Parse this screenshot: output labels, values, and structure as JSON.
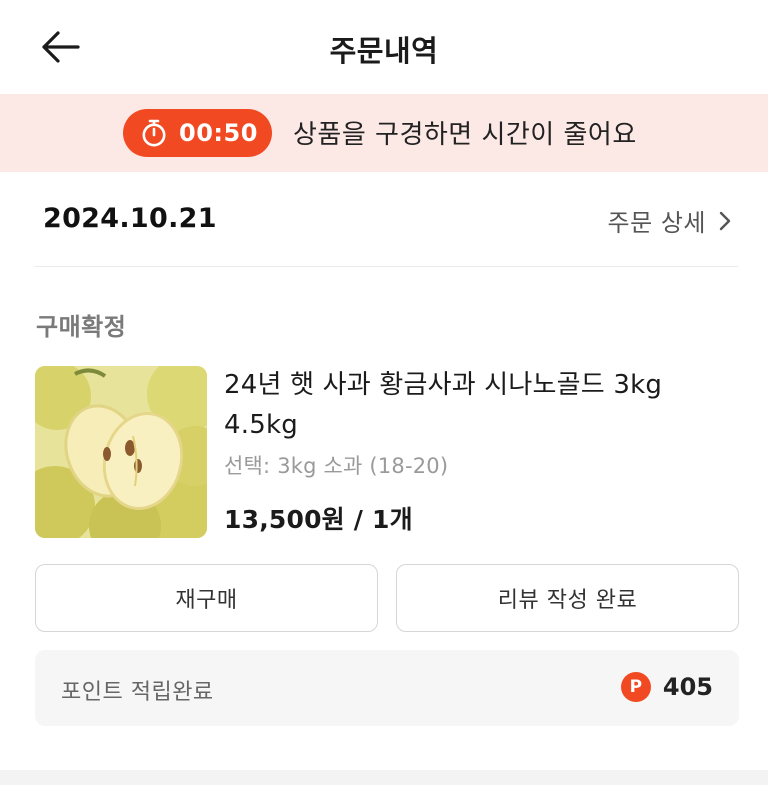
{
  "header": {
    "title": "주문내역",
    "back_icon": "arrow-left-icon"
  },
  "timer_banner": {
    "timer": "00:50",
    "timer_icon": "stopwatch-icon",
    "message": "상품을 구경하면 시간이 줄어요",
    "accent_color": "#f14a23",
    "background_color": "#fce9e6"
  },
  "order": {
    "date": "2024.10.21",
    "detail_link": "주문 상세",
    "status": "구매확정",
    "product": {
      "name": "24년 햇 사과 황금사과 시나노골드 3kg 4.5kg",
      "option": "선택: 3kg 소과 (18-20)",
      "price": "13,500원 / 1개",
      "image": "golden-apples-photo"
    },
    "buttons": {
      "rebuy": "재구매",
      "review": "리뷰 작성 완료"
    },
    "points": {
      "label": "포인트 적립완료",
      "icon_letter": "P",
      "value": "405"
    }
  }
}
